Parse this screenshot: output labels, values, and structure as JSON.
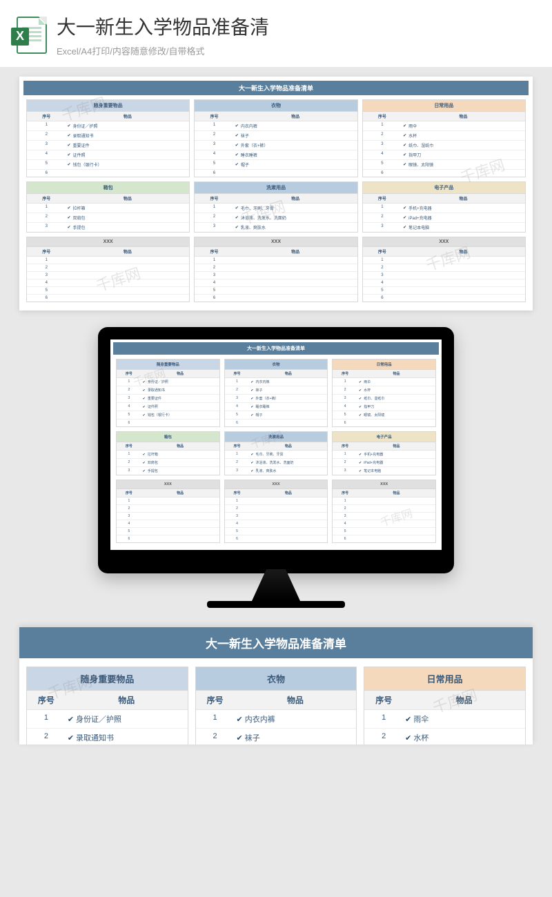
{
  "header": {
    "title": "大一新生入学物品准备清",
    "subtitle": "Excel/A4打印/内容随意修改/自带格式",
    "icon_letter": "X"
  },
  "doc": {
    "title": "大一新生入学物品准备清单",
    "col_num": "序号",
    "col_item": "物品",
    "watermark": "千库网"
  },
  "categories": [
    {
      "name": "随身重要物品",
      "color": "c-blue",
      "items": [
        "身份证／护照",
        "录取通知书",
        "重要证件",
        "证件照",
        "钱包（银行卡）",
        ""
      ]
    },
    {
      "name": "衣物",
      "color": "c-blue2",
      "items": [
        "内衣内裤",
        "袜子",
        "外套（衣+裤）",
        "睡衣睡裤",
        "帽子",
        ""
      ]
    },
    {
      "name": "日常用品",
      "color": "c-orange",
      "items": [
        "雨伞",
        "水杯",
        "纸巾、湿纸巾",
        "指甲刀",
        "眼镜、太阳镜",
        ""
      ]
    },
    {
      "name": "箱包",
      "color": "c-green",
      "items": [
        "拉杆箱",
        "双肩包",
        "手提包"
      ]
    },
    {
      "name": "洗漱用品",
      "color": "c-blue2",
      "items": [
        "毛巾、牙刷、牙膏",
        "沐浴液、洗发水、洗面奶",
        "乳液、爽肤水"
      ]
    },
    {
      "name": "电子产品",
      "color": "c-beige",
      "items": [
        "手机+充电器",
        "iPad+充电器",
        "笔记本电脑"
      ]
    },
    {
      "name": "XXX",
      "color": "c-gray",
      "items": [
        "",
        "",
        "",
        "",
        "",
        ""
      ]
    },
    {
      "name": "XXX",
      "color": "c-gray",
      "items": [
        "",
        "",
        "",
        "",
        "",
        ""
      ]
    },
    {
      "name": "XXX",
      "color": "c-gray",
      "items": [
        "",
        "",
        "",
        "",
        "",
        ""
      ]
    }
  ],
  "bottom_rows": 2
}
